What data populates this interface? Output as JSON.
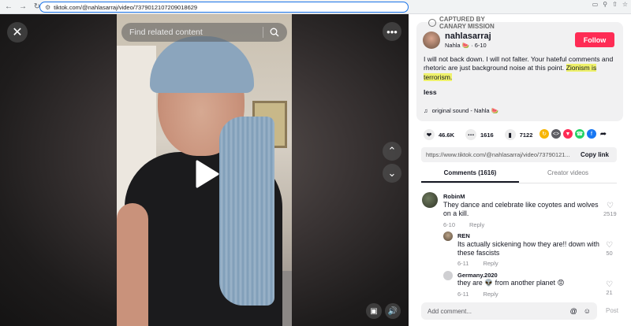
{
  "browser": {
    "url": "tiktok.com/@nahlasarraj/video/7379012107209018629"
  },
  "video": {
    "search_placeholder": "Find related content"
  },
  "watermark": {
    "line1": "CAPTURED BY",
    "line2": "CANARY MISSION"
  },
  "author": {
    "username": "nahlasarraj",
    "display_name": "Nahla 🍉",
    "date": "6-10",
    "follow_label": "Follow"
  },
  "caption": {
    "text_plain": "I will not back down. I will not falter. Your hateful comments and rhetoric are just background noise at this point. ",
    "text_highlight": "Zionism is terrorism.",
    "less_label": "less"
  },
  "sound": {
    "label": "original sound - Nahla 🍉"
  },
  "stats": {
    "likes": "46.6K",
    "comments": "1616",
    "saves": "7122"
  },
  "share_link": {
    "url": "https://www.tiktok.com/@nahlasarraj/video/73790121...",
    "copy_label": "Copy link"
  },
  "tabs": {
    "comments": "Comments (1616)",
    "creator_videos": "Creator videos"
  },
  "comments": [
    {
      "name": "RobinM",
      "text": "They dance and celebrate like coyotes and wolves on a kill.",
      "date": "6-10",
      "reply": "Reply",
      "likes": "2519"
    },
    {
      "name": "REN",
      "text": "Its actually sickening how they are!! down with these fascists",
      "date": "6-11",
      "reply": "Reply",
      "likes": "50"
    },
    {
      "name": "Germany.2020",
      "text": "they are 👽 from another planet 😡",
      "date": "6-11",
      "reply": "Reply",
      "likes": "21"
    }
  ],
  "add_comment": {
    "placeholder": "Add comment...",
    "post_label": "Post"
  },
  "colors": {
    "brand": "#fe2c55",
    "highlight": "#eef16b"
  }
}
